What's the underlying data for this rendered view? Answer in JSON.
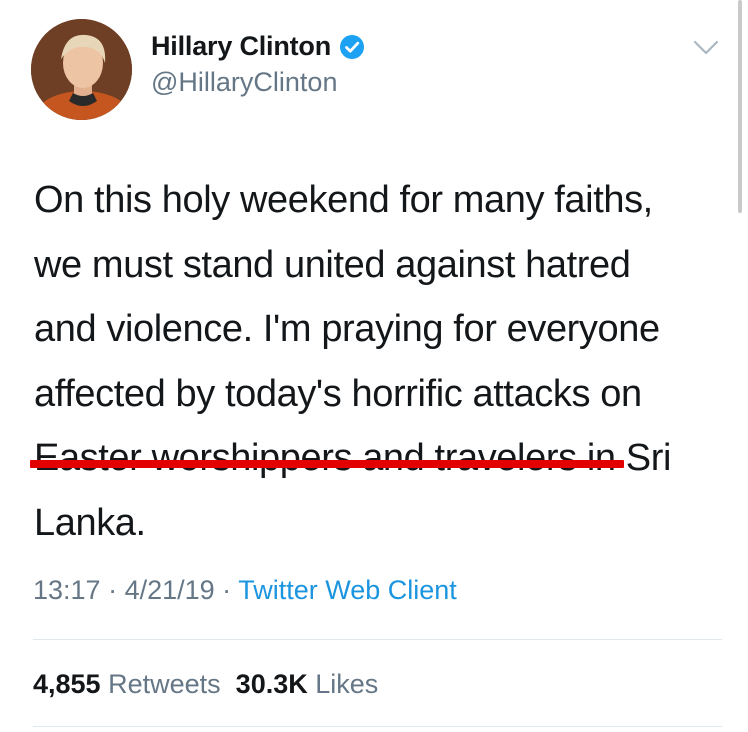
{
  "author": {
    "name": "Hillary Clinton",
    "handle": "@HillaryClinton"
  },
  "tweet": {
    "lines": [
      "On this holy weekend for many faiths,",
      "we must stand united against hatred",
      "and violence. I'm praying for everyone",
      "affected by today's horrific attacks on",
      "Easter worshippers and travelers in Sri",
      "Lanka."
    ]
  },
  "meta": {
    "time": "13:17",
    "sep1": " · ",
    "date": "4/21/19",
    "sep2": " · ",
    "client": "Twitter Web Client"
  },
  "stats": {
    "retweets_count": "4,855",
    "retweets_label": "Retweets",
    "likes_count": "30.3K",
    "likes_label": "Likes"
  },
  "icons": {
    "verified": "verified-badge-icon",
    "more": "chevron-down-icon"
  },
  "colors": {
    "text": "#14171a",
    "secondary": "#657786",
    "link": "#1b95e0",
    "verified": "#1da1f2",
    "annotation_underline": "#e30000"
  }
}
